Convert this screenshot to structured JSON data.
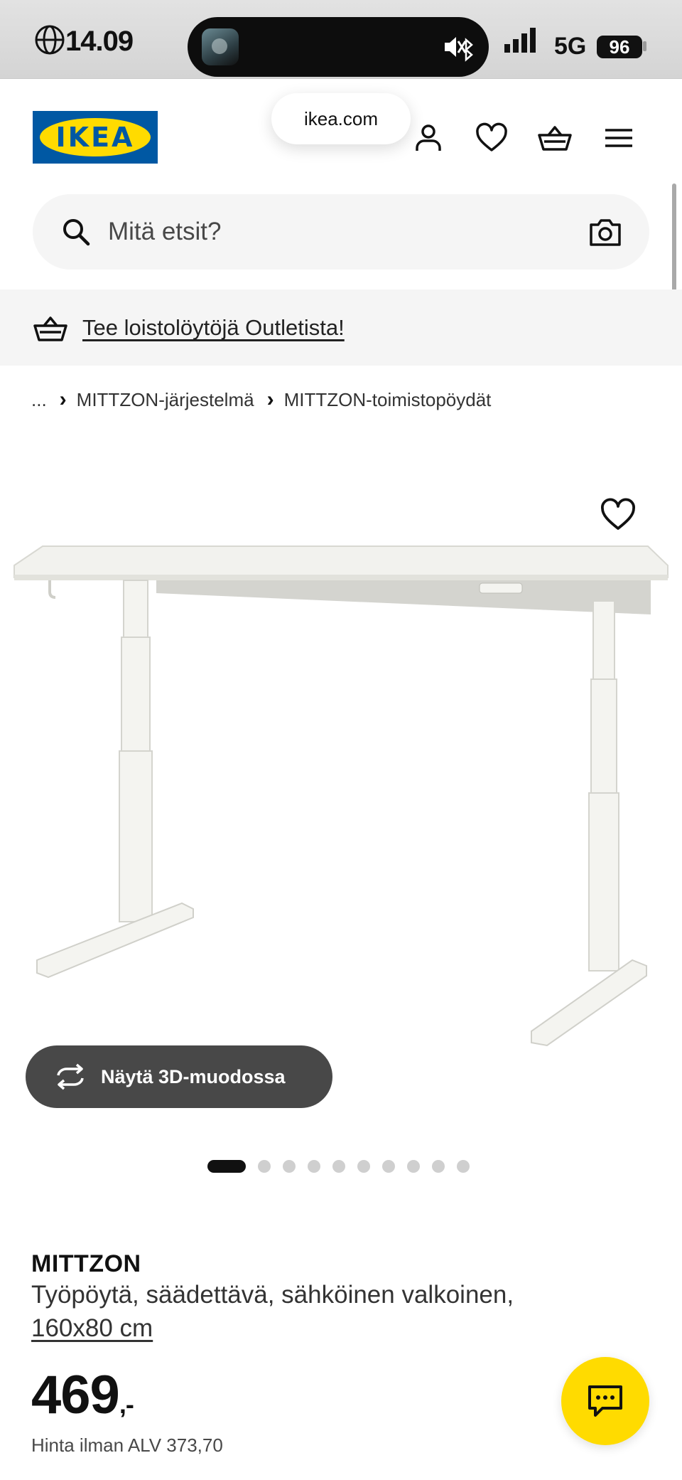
{
  "status_bar": {
    "time": "14.09",
    "network": "5G",
    "battery": "96"
  },
  "header": {
    "logo_text": "IKEA",
    "url": "ikea.com"
  },
  "search": {
    "placeholder": "Mitä etsit?"
  },
  "banner": {
    "text": "Tee loistolöytöjä Outletista!"
  },
  "breadcrumb": {
    "ellipsis": "...",
    "items": [
      "MITTZON-järjestelmä",
      "MITTZON-toimistopöydät"
    ]
  },
  "gallery": {
    "view_3d_label": "Näytä 3D-muodossa",
    "current_image": 1,
    "total_images": 10
  },
  "product": {
    "name": "MITTZON",
    "description": "Työpöytä, säädettävä, sähköinen valkoinen,",
    "size": "160x80 cm",
    "price": "469",
    "price_suffix": ",-",
    "vat_text": "Hinta ilman ALV 373,70"
  },
  "colors": {
    "ikea_blue": "#0058a3",
    "ikea_yellow": "#ffdb00",
    "button_dark": "#484848"
  }
}
